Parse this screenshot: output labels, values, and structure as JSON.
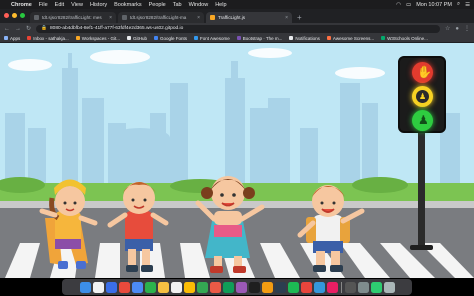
{
  "menubar": {
    "app_name": "Chrome",
    "items": [
      "File",
      "Edit",
      "View",
      "History",
      "Bookmarks",
      "People",
      "Tab",
      "Window",
      "Help"
    ],
    "clock": "Mon 10:07 PM"
  },
  "tabs": [
    {
      "title": "tdt.sjscr8282/trafficLight: mes"
    },
    {
      "title": "tdt.sjscr8282/trafficLight-ma"
    },
    {
      "title": "TrafficLight.js",
      "active": true
    }
  ],
  "address": {
    "url": "8080-ab4dbfb4-8ef1-41ff-a77f-63fdf4e2d365.ws-us02.gitpod.io"
  },
  "bookmarks": [
    "Apps",
    "Inbox - sathakja...",
    "Workspaces - Git...",
    "GitHub",
    "Google Fonts",
    "Font Awesome",
    "Bootstrap · The m...",
    "Notifications",
    "Awesome Screens...",
    "W3Schools Online..."
  ],
  "traffic_light": {
    "states": [
      "stop",
      "wait",
      "walk"
    ],
    "active_color": "#2ecc40",
    "stop_color": "#e23b2e",
    "wait_color": "#f7d223"
  },
  "colors": {
    "sky": "#bfe7f5",
    "skyline": "#a9d3e8",
    "grass": "#7cc452",
    "road": "#7a7c80"
  },
  "dock": {
    "icon_colors": [
      "#3c8ee8",
      "#f2f2f2",
      "#3a6ee8",
      "#e84a3c",
      "#4c8bf5",
      "#2bb24c",
      "#f6c042",
      "#f1f1f1",
      "#fbbc05",
      "#34a853",
      "#eb5a46",
      "#0f9d58",
      "#9b59b6",
      "#1f1f1f",
      "#f39c12",
      "#2c3e50",
      "#1db954",
      "#e8453c",
      "#3498db",
      "#e91e63",
      "#555555",
      "#7f8c8d",
      "#2ecc71",
      "#aab7b8"
    ]
  }
}
